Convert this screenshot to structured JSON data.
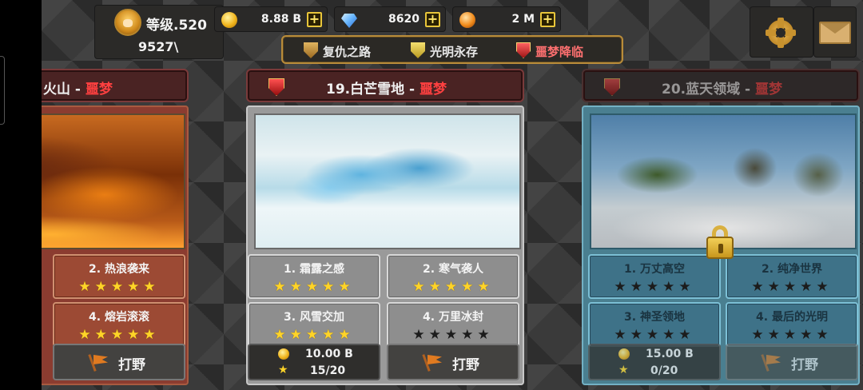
{
  "header": {
    "level_label": "等级.520",
    "power_value": "9527\\",
    "resources": [
      {
        "name": "gold",
        "icon": "gold-coin-icon",
        "value": "8.88 B"
      },
      {
        "name": "diamond",
        "icon": "diamond-icon",
        "value": "8620"
      },
      {
        "name": "orb",
        "icon": "orange-orb-icon",
        "value": "2 M"
      }
    ],
    "modes": [
      {
        "label": "复仇之路",
        "icon": "bronze-shield-icon"
      },
      {
        "label": "光明永存",
        "icon": "gold-shield-icon"
      },
      {
        "label": "噩梦降临",
        "icon": "red-shield-icon",
        "active": true
      }
    ]
  },
  "maps": [
    {
      "name": "火山",
      "difficulty": "噩梦",
      "stages": [
        {
          "label": "2. 热浪袭来",
          "stars": 5
        },
        {
          "label": "4. 熔岩滚滚",
          "stars": 5
        }
      ],
      "hunt_label": "打野"
    },
    {
      "name": "19.白芒雪地",
      "difficulty": "噩梦",
      "stages": [
        {
          "label": "1. 霜露之感",
          "stars": 5
        },
        {
          "label": "2. 寒气袭人",
          "stars": 5
        },
        {
          "label": "3. 风雪交加",
          "stars": 5
        },
        {
          "label": "4. 万里冰封",
          "stars": 0
        }
      ],
      "reward_gold": "10.00 B",
      "star_progress": "15/20",
      "hunt_label": "打野"
    },
    {
      "name": "20.蓝天领域",
      "difficulty": "噩梦",
      "locked": true,
      "stages": [
        {
          "label": "1. 万丈高空",
          "stars": 0
        },
        {
          "label": "2. 纯净世界",
          "stars": 0
        },
        {
          "label": "3. 神圣领地",
          "stars": 0
        },
        {
          "label": "4. 最后的光明",
          "stars": 0
        }
      ],
      "reward_gold": "15.00 B",
      "star_progress": "0/20",
      "hunt_label": "打野"
    }
  ],
  "separator": "-",
  "star_glyph": "★",
  "colors": {
    "difficulty": "#ff4040",
    "star_gold": "#ffd428",
    "frame_gold": "#b98c3a"
  }
}
